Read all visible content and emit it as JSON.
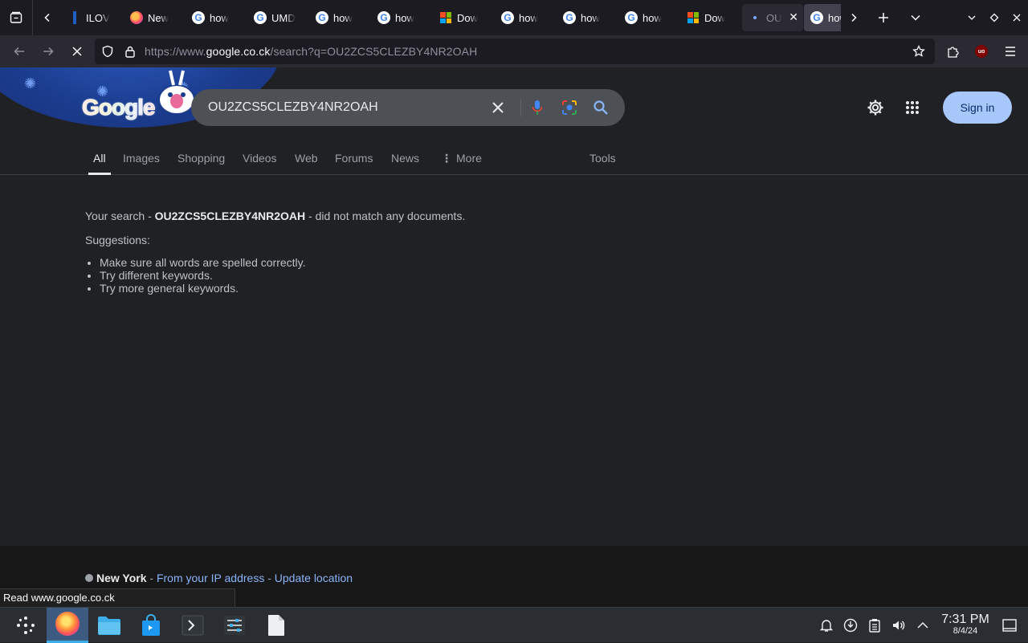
{
  "browser": {
    "tabs": [
      {
        "label": "ILOV",
        "favicon": "ilovepdf-icon"
      },
      {
        "label": "New",
        "favicon": "firefox-icon"
      },
      {
        "label": "how",
        "favicon": "google-icon"
      },
      {
        "label": "UMD",
        "favicon": "google-icon"
      },
      {
        "label": "how",
        "favicon": "google-icon"
      },
      {
        "label": "how",
        "favicon": "google-icon"
      },
      {
        "label": "Dow",
        "favicon": "microsoft-icon"
      },
      {
        "label": "how",
        "favicon": "google-icon"
      },
      {
        "label": "how",
        "favicon": "google-icon"
      },
      {
        "label": "how",
        "favicon": "google-icon"
      },
      {
        "label": "Dow",
        "favicon": "microsoft-icon"
      },
      {
        "label": "OU",
        "favicon": "loading-icon"
      },
      {
        "label": "how",
        "favicon": "google-icon"
      }
    ],
    "url": {
      "prefix": "https://www.",
      "domain": "google.co.ck",
      "path": "/search?q=OU2ZCS5CLEZBY4NR2OAH"
    },
    "status_text": "Read www.google.co.ck"
  },
  "google": {
    "logo_text": "Google",
    "query": "OU2ZCS5CLEZBY4NR2OAH",
    "sign_in": "Sign in",
    "tabs": [
      "All",
      "Images",
      "Shopping",
      "Videos",
      "Web",
      "Forums",
      "News",
      "More"
    ],
    "tools": "Tools",
    "result": {
      "prefix": "Your search - ",
      "query": "OU2ZCS5CLEZBY4NR2OAH",
      "suffix": " - did not match any documents.",
      "suggestions_label": "Suggestions:",
      "suggestions": [
        "Make sure all words are spelled correctly.",
        "Try different keywords.",
        "Try more general keywords."
      ]
    },
    "footer": {
      "city": "New York",
      "sep1": " - ",
      "from_ip": "From your IP address",
      "sep2": " - ",
      "update": "Update location"
    },
    "colors": {
      "accent": "#8ab4f8",
      "signin_bg": "#a8c7fa",
      "page_bg": "#202124"
    }
  },
  "taskbar": {
    "clock_time": "7:31 PM",
    "clock_date": "8/4/24"
  }
}
